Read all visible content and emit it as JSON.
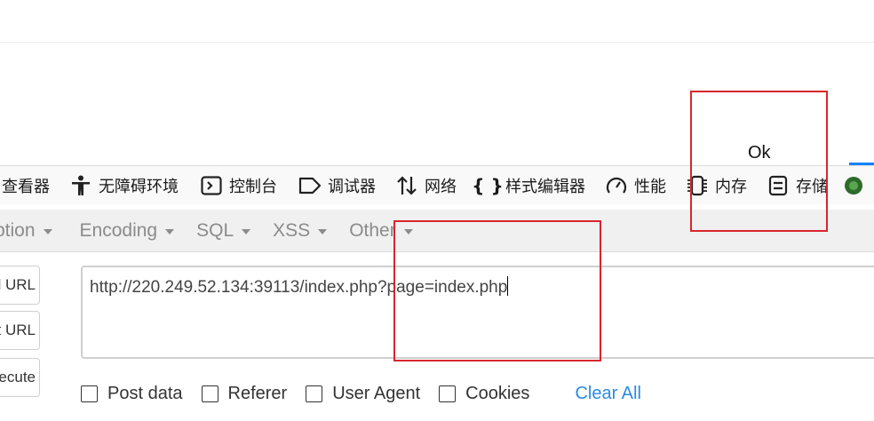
{
  "page": {
    "text": "Ok"
  },
  "devtools": {
    "tabs": [
      {
        "label": "查看器",
        "icon": "inspector-icon"
      },
      {
        "label": "无障碍环境",
        "icon": "accessibility-icon"
      },
      {
        "label": "控制台",
        "icon": "console-icon"
      },
      {
        "label": "调试器",
        "icon": "debugger-icon"
      },
      {
        "label": "网络",
        "icon": "network-icon"
      },
      {
        "label": "样式编辑器",
        "icon": "style-editor-icon"
      },
      {
        "label": "性能",
        "icon": "performance-icon"
      },
      {
        "label": "内存",
        "icon": "memory-icon"
      },
      {
        "label": "存储",
        "icon": "storage-icon"
      }
    ]
  },
  "hackbar": {
    "menu": [
      {
        "label": "ption"
      },
      {
        "label": "Encoding"
      },
      {
        "label": "SQL"
      },
      {
        "label": "XSS"
      },
      {
        "label": "Other"
      }
    ],
    "buttons": {
      "load": "ad URL",
      "split": "it URL",
      "execute": "ecute"
    },
    "url_value": "http://220.249.52.134:39113/index.php?page=index.php",
    "options": [
      {
        "label": "Post data",
        "checked": false
      },
      {
        "label": "Referer",
        "checked": false
      },
      {
        "label": "User Agent",
        "checked": false
      },
      {
        "label": "Cookies",
        "checked": false
      }
    ],
    "clear_all": "Clear All"
  },
  "colors": {
    "highlight_box": "#d8262c",
    "link": "#2b8ae5",
    "active_tab": "#0a84ff"
  }
}
